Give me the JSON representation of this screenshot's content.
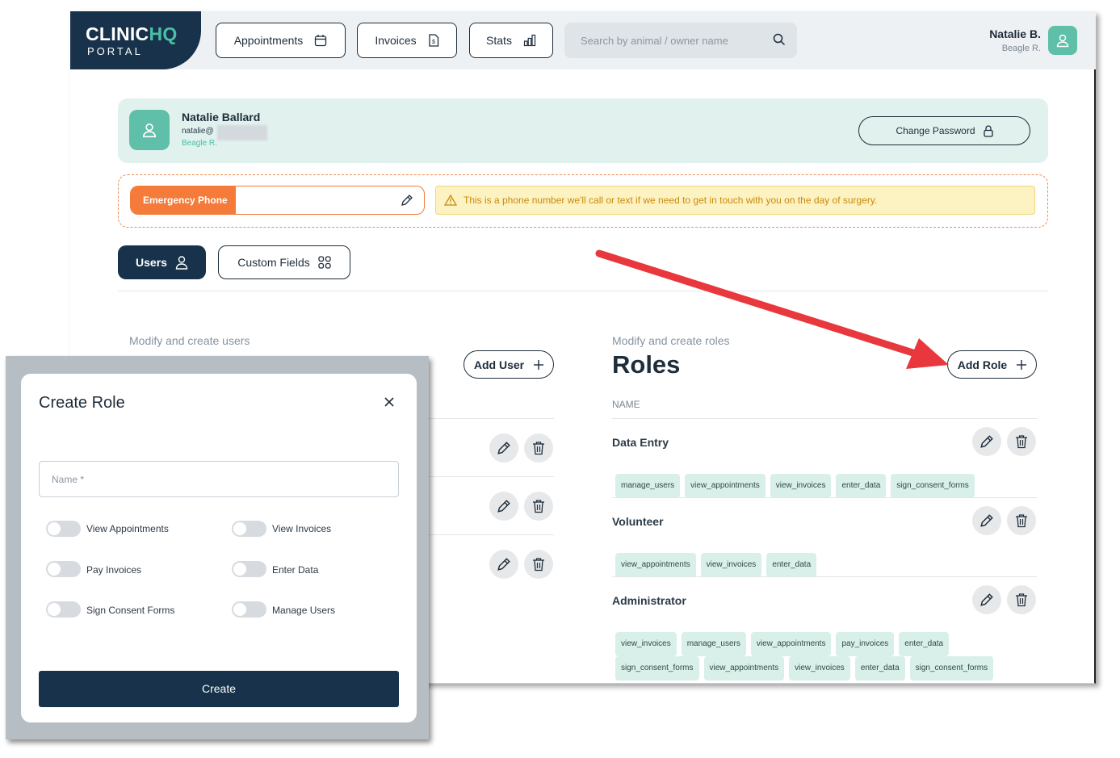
{
  "header": {
    "logo_main": "CLINIC",
    "logo_accent": "HQ",
    "logo_sub": "PORTAL",
    "nav": [
      {
        "label": "Appointments"
      },
      {
        "label": "Invoices"
      },
      {
        "label": "Stats"
      }
    ],
    "search_placeholder": "Search by animal / owner name",
    "user_name": "Natalie B.",
    "user_clinic": "Beagle R."
  },
  "profile": {
    "name": "Natalie Ballard",
    "email": "natalie@",
    "clinic": "Beagle R.",
    "change_password": "Change Password"
  },
  "emergency": {
    "label": "Emergency Phone",
    "value": "",
    "note": "This is a phone number we'll call or text if we need to get in touch with you on the day of surgery."
  },
  "tabs": [
    {
      "label": "Users"
    },
    {
      "label": "Custom Fields"
    }
  ],
  "users_panel": {
    "subtitle": "Modify and create users",
    "add_label": "Add User"
  },
  "roles_panel": {
    "subtitle": "Modify and create roles",
    "title": "Roles",
    "add_label": "Add Role",
    "column": "NAME",
    "roles": [
      {
        "name": "Data Entry",
        "permissions": [
          "manage_users",
          "view_appointments",
          "view_invoices",
          "enter_data",
          "sign_consent_forms"
        ]
      },
      {
        "name": "Volunteer",
        "permissions": [
          "view_appointments",
          "view_invoices",
          "enter_data"
        ]
      },
      {
        "name": "Administrator",
        "permissions": [
          "view_invoices",
          "manage_users",
          "view_appointments",
          "pay_invoices",
          "enter_data",
          "sign_consent_forms",
          "view_appointments",
          "view_invoices",
          "enter_data",
          "sign_consent_forms"
        ]
      }
    ]
  },
  "modal": {
    "title": "Create Role",
    "name_placeholder": "Name *",
    "toggles": [
      "View Appointments",
      "View Invoices",
      "Pay Invoices",
      "Enter Data",
      "Sign Consent Forms",
      "Manage Users"
    ],
    "toggle_states": [
      false,
      false,
      false,
      false,
      false,
      false
    ],
    "create_label": "Create"
  },
  "colors": {
    "navy": "#17324a",
    "teal": "#5fbfa8",
    "orange": "#f47b3a",
    "annotation_arrow": "#e8383d"
  }
}
